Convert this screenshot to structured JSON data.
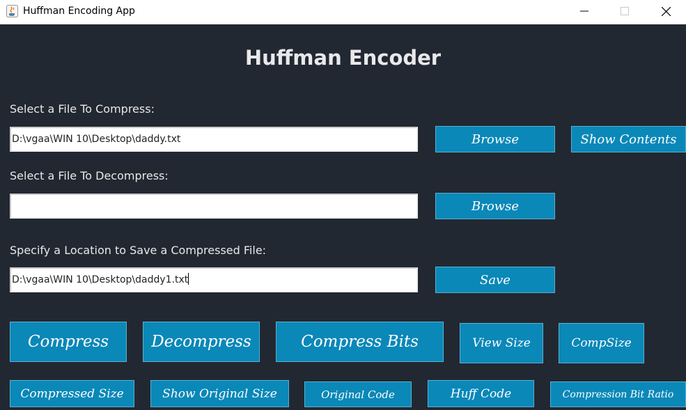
{
  "window": {
    "title": "Huffman Encoding App",
    "minimize_glyph": "—",
    "close_glyph": "✕"
  },
  "heading": "Huffman Encoder",
  "compress": {
    "label": "Select a File To Compress:",
    "path": "D:\\vgaa\\WIN 10\\Desktop\\daddy.txt",
    "browse_label": "Browse",
    "show_contents_label": "Show Contents"
  },
  "decompress": {
    "label": "Select a File To Decompress:",
    "path": "",
    "browse_label": "Browse"
  },
  "save": {
    "label": "Specify a Location to Save a Compressed File:",
    "path": "D:\\vgaa\\WIN 10\\Desktop\\daddy1.txt",
    "save_label": "Save"
  },
  "actions_row1": [
    "Compress",
    "Decompress",
    "Compress Bits",
    "View Size",
    "CompSize"
  ],
  "actions_row2": [
    "Compressed Size",
    "Show Original Size",
    "Original Code",
    "Huff Code",
    "Compression Bit Ratio"
  ],
  "colors": {
    "background": "#222831",
    "button": "#0a88b8",
    "text": "#e8e8ea"
  }
}
